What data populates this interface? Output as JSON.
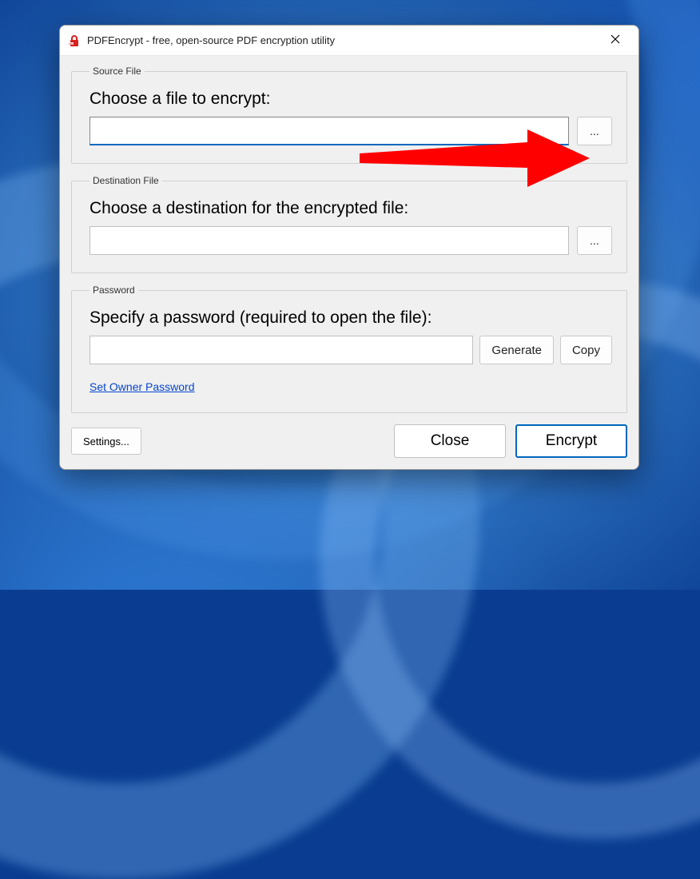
{
  "window": {
    "title": "PDFEncrypt - free, open-source PDF encryption utility"
  },
  "source": {
    "legend": "Source File",
    "prompt": "Choose a file to encrypt:",
    "value": "",
    "browse_label": "..."
  },
  "destination": {
    "legend": "Destination File",
    "prompt": "Choose a destination for the encrypted file:",
    "value": "",
    "browse_label": "..."
  },
  "password": {
    "legend": "Password",
    "prompt": "Specify a password (required to open the file):",
    "value": "",
    "generate_label": "Generate",
    "copy_label": "Copy",
    "owner_link": "Set Owner Password"
  },
  "buttons": {
    "settings": "Settings...",
    "close": "Close",
    "encrypt": "Encrypt"
  },
  "annotation": {
    "arrow_color": "#ff0000"
  }
}
